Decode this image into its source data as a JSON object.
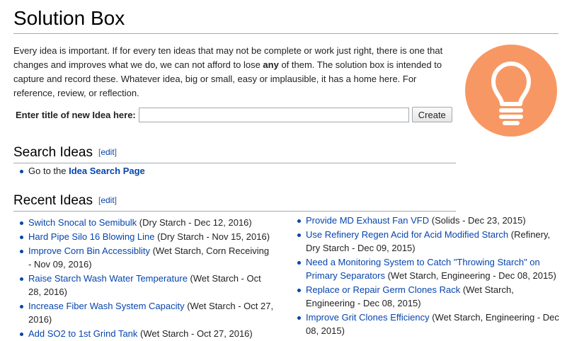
{
  "page": {
    "title": "Solution Box",
    "intro": {
      "part1": "Every idea is important. If for every ten ideas that may not be complete or work just right, there is one that changes and improves what we do, we can not afford to lose ",
      "bold": "any",
      "part2": " of them. The solution box is intended to capture and record these. Whatever idea, big or small, easy or implausible, it has a home here. For reference, review, or reflection."
    },
    "logo_icon": "lightbulb-icon",
    "accent_color": "#f79864"
  },
  "create_form": {
    "label": "Enter title of new Idea here:",
    "input_value": "",
    "button_label": "Create"
  },
  "search_section": {
    "heading": "Search Ideas",
    "edit_label": "edit",
    "item_prefix": "Go to the ",
    "item_link": "Idea Search Page"
  },
  "recent_section": {
    "heading": "Recent Ideas",
    "edit_label": "edit",
    "left": [
      {
        "title": "Switch Snocal to Semibulk",
        "meta": " (Dry Starch - Dec 12, 2016)"
      },
      {
        "title": "Hard Pipe Silo 16 Blowing Line",
        "meta": " (Dry Starch - Nov 15, 2016)"
      },
      {
        "title": "Improve Corn Bin Accessiblity",
        "meta": " (Wet Starch, Corn Receiving - Nov 09, 2016)"
      },
      {
        "title": "Raise Starch Wash Water Temperature",
        "meta": " (Wet Starch - Oct 28, 2016)"
      },
      {
        "title": "Increase Fiber Wash System Capacity",
        "meta": " (Wet Starch - Oct 27, 2016)"
      },
      {
        "title": "Add SO2 to 1st Grind Tank",
        "meta": " (Wet Starch - Oct 27, 2016)"
      }
    ],
    "right": [
      {
        "title": "Provide MD Exhaust Fan VFD",
        "meta": " (Solids - Dec 23, 2015)"
      },
      {
        "title": "Use Refinery Regen Acid for Acid Modified Starch",
        "meta": " (Refinery, Dry Starch - Dec 09, 2015)"
      },
      {
        "title": "Need a Monitoring System to Catch \"Throwing Starch\" on Primary Separators",
        "meta": " (Wet Starch, Engineering - Dec 08, 2015)"
      },
      {
        "title": "Replace or Repair Germ Clones Rack",
        "meta": " (Wet Starch, Engineering - Dec 08, 2015)"
      },
      {
        "title": "Improve Grit Clones Efficiency",
        "meta": " (Wet Starch, Engineering - Dec 08, 2015)"
      }
    ]
  }
}
